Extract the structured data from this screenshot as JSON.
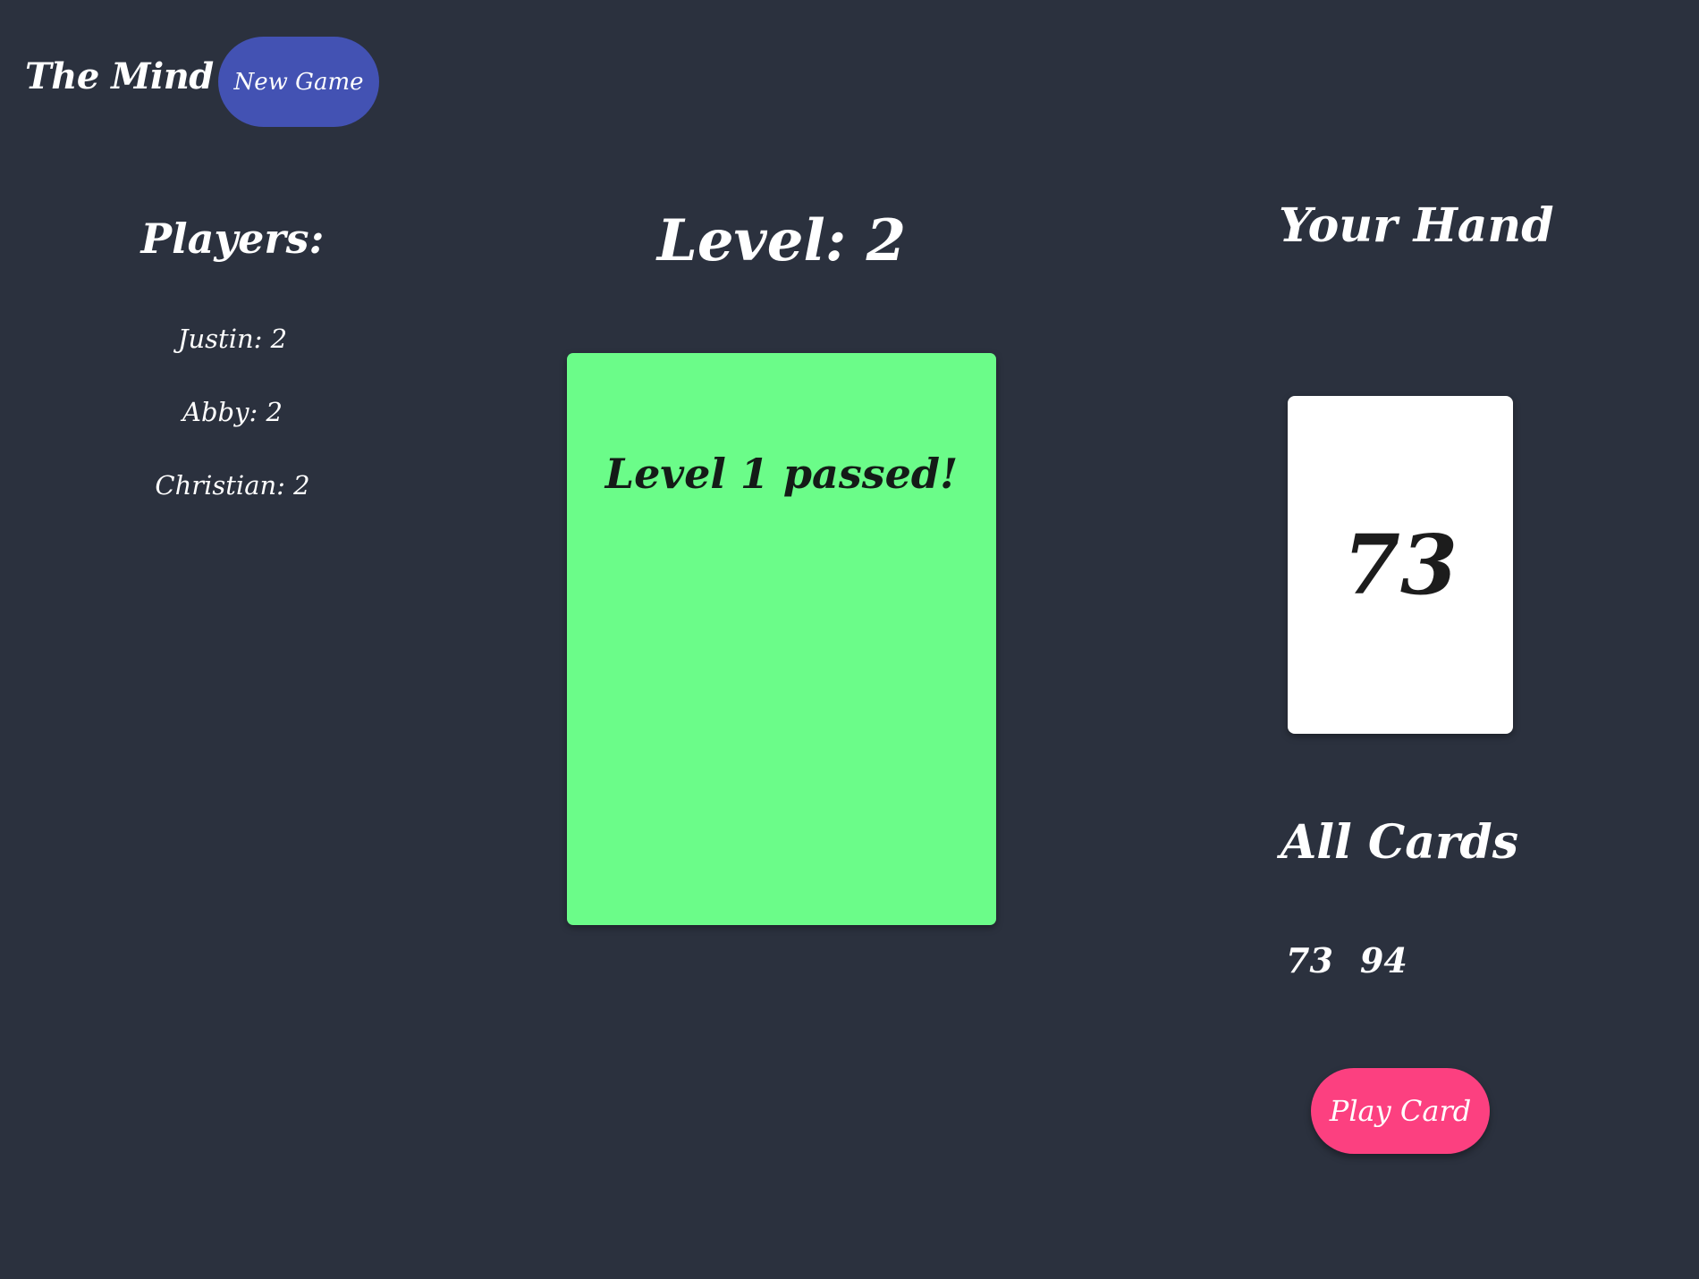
{
  "header": {
    "app_title": "The Mind",
    "new_game_label": "New Game"
  },
  "players": {
    "heading": "Players:",
    "list": [
      {
        "label": "Justin: 2"
      },
      {
        "label": "Abby: 2"
      },
      {
        "label": "Christian: 2"
      }
    ]
  },
  "level": {
    "heading": "Level: 2"
  },
  "pile": {
    "message": "Level 1 passed!",
    "color": "#6bfc89"
  },
  "hand": {
    "heading": "Your Hand",
    "selected_card": "73"
  },
  "all_cards": {
    "heading": "All Cards",
    "cards": [
      "73",
      "94"
    ]
  },
  "actions": {
    "play_card_label": "Play Card"
  },
  "colors": {
    "background": "#2b313e",
    "new_game_button": "#4352b3",
    "play_card_button": "#fc4080",
    "card_face": "#ffffff"
  }
}
